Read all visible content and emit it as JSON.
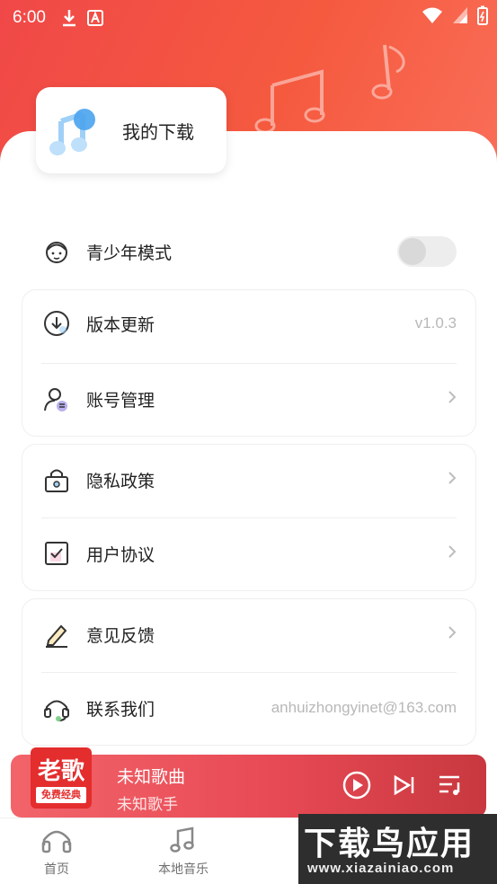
{
  "status_bar": {
    "time": "6:00"
  },
  "my_download": {
    "label": "我的下载"
  },
  "teen_mode": {
    "label": "青少年模式",
    "enabled": false
  },
  "version": {
    "label": "版本更新",
    "value": "v1.0.3"
  },
  "account": {
    "label": "账号管理"
  },
  "privacy": {
    "label": "隐私政策"
  },
  "agreement": {
    "label": "用户协议"
  },
  "feedback": {
    "label": "意见反馈"
  },
  "contact": {
    "label": "联系我们",
    "value": "anhuizhongyinet@163.com"
  },
  "player": {
    "album_title": "老歌",
    "album_badge": "免费经典",
    "song_title": "未知歌曲",
    "artist": "未知歌手"
  },
  "tabs": [
    {
      "label": "首页",
      "icon": "headphones-icon"
    },
    {
      "label": "本地音乐",
      "icon": "music-note-icon"
    }
  ],
  "watermark": {
    "line1": "下载鸟应用",
    "line2": "www.xiazainiao.com"
  },
  "colors": {
    "accent": "#f04848",
    "player": "#e84a55"
  }
}
